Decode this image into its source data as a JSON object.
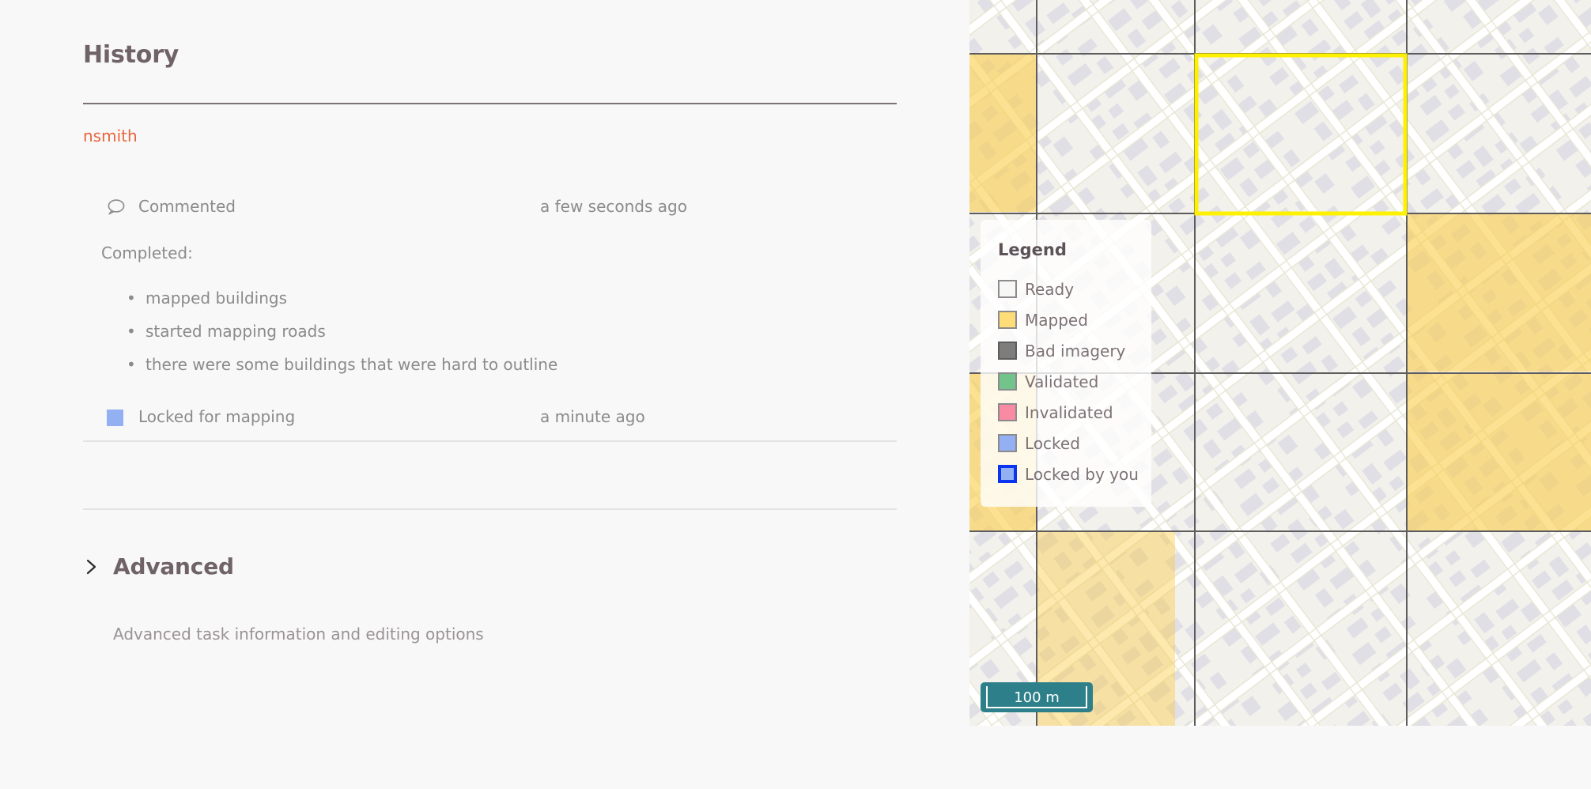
{
  "history": {
    "title": "History",
    "author": "nsmith",
    "entries": [
      {
        "icon": "comment-icon",
        "label": "Commented",
        "time": "a few seconds ago"
      },
      {
        "icon": "locked-swatch-icon",
        "label": "Locked for mapping",
        "time": "a minute ago"
      }
    ],
    "comment": {
      "heading": "Completed:",
      "bullets": [
        "mapped buildings",
        "started mapping roads",
        "there were some buildings that were hard to outline"
      ]
    }
  },
  "advanced": {
    "title": "Advanced",
    "description": "Advanced task information and editing options",
    "chevron": "chevron-right-icon"
  },
  "map": {
    "legend": {
      "title": "Legend",
      "items": [
        {
          "label": "Ready",
          "color": "#f7f7f5",
          "border": "#8c8a8c"
        },
        {
          "label": "Mapped",
          "color": "#fcdd78",
          "border": "#8c8a8c"
        },
        {
          "label": "Bad imagery",
          "color": "#7d7d7d",
          "border": "#5c5c5c"
        },
        {
          "label": "Validated",
          "color": "#72c48a",
          "border": "#8c8a8c"
        },
        {
          "label": "Invalidated",
          "color": "#f98aa4",
          "border": "#8c8a8c"
        },
        {
          "label": "Locked",
          "color": "#93b0f2",
          "border": "#8c8a8c"
        },
        {
          "label": "Locked by you",
          "color": "#93b0f2",
          "border": "#0b34f0"
        }
      ]
    },
    "scale": {
      "label": "100 m"
    },
    "colors": {
      "grid_line": "#5c5c5c",
      "mapped_fill": "#facd4b",
      "selection_outline": "#fdf100",
      "base": "#f2f1ec"
    }
  }
}
